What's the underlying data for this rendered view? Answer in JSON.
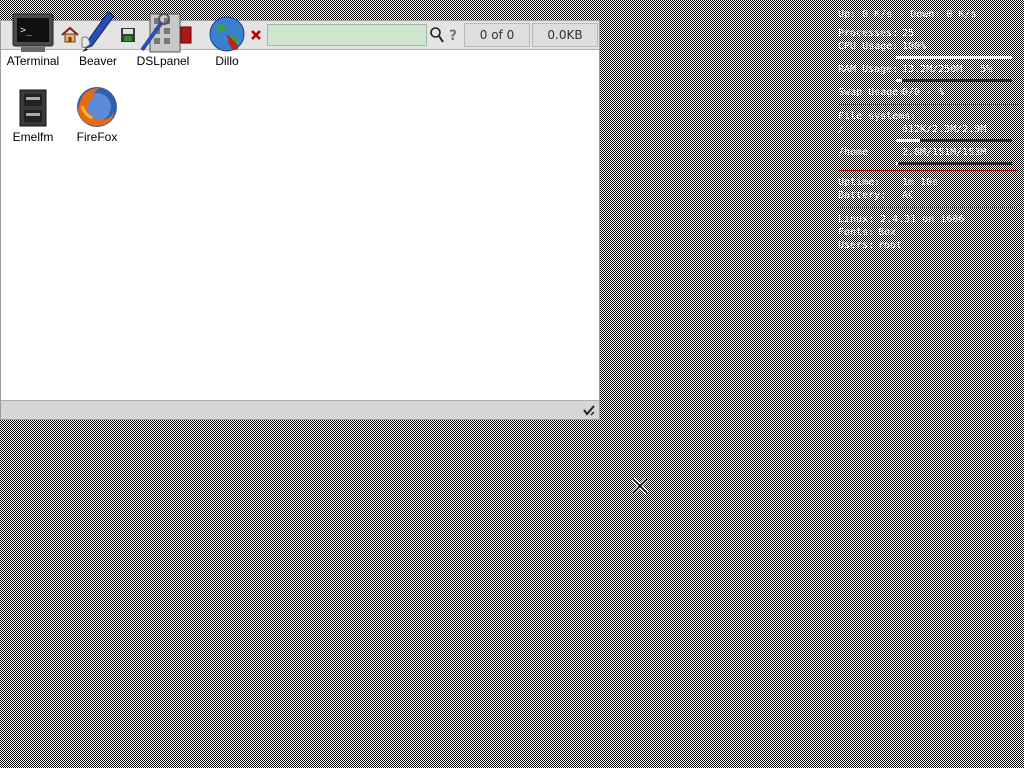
{
  "desktop": {
    "icons": [
      {
        "label": "ATerminal",
        "icon": "terminal-icon"
      },
      {
        "label": "Beaver",
        "icon": "text-editor-icon"
      },
      {
        "label": "DSLpanel",
        "icon": "control-panel-icon"
      },
      {
        "label": "Dillo",
        "icon": "globe-icon"
      },
      {
        "label": "Emelfm",
        "icon": "file-manager-icon"
      },
      {
        "label": "FireFox",
        "icon": "firefox-icon"
      }
    ]
  },
  "dillo": {
    "url_value": "",
    "page_counter": "0 of 0",
    "bytes_loaded": "0.0KB",
    "toolbar_icons": [
      "home-icon",
      "save-icon",
      "bookmark-icon",
      "stop-icon",
      "search-icon",
      "help-icon"
    ]
  },
  "monitor": {
    "net": "Up: 0 K/s - Down: 0 K/s",
    "processes": {
      "label": "Processes:",
      "value": "25"
    },
    "cpu": {
      "label": "CPU Usage:",
      "value": "100%",
      "fill": 1.0
    },
    "ram": {
      "label": "RAM Usage:",
      "value": "13.2M/250M - 5%",
      "fill": 0.05
    },
    "swap": {
      "label": "Swap Usage:",
      "value": "0/0 - %"
    },
    "fs_header": "File systems:",
    "fs_root": {
      "label": "/",
      "value": "612K/2.3M/2.9M",
      "fill": 0.21
    },
    "fs_home": {
      "label": "/home",
      "value": "2.8M/151M/153M",
      "fill": 0.02
    },
    "uptime": {
      "label": "Uptime:",
      "value": "1m 10s"
    },
    "battery": {
      "label": "Battery:",
      "value": "AC"
    },
    "kernel": "Linux: 2.4.31 on i686",
    "fonts": {
      "label": "Fonts:",
      "value": "Box"
    },
    "users": {
      "label": "Users:",
      "value": "root"
    }
  },
  "colors": {
    "url_bg": "#cde6cd",
    "toolbar_bg": "#e4e4e4",
    "accent_red": "#c00000",
    "accent_green": "#2a9a2a"
  }
}
